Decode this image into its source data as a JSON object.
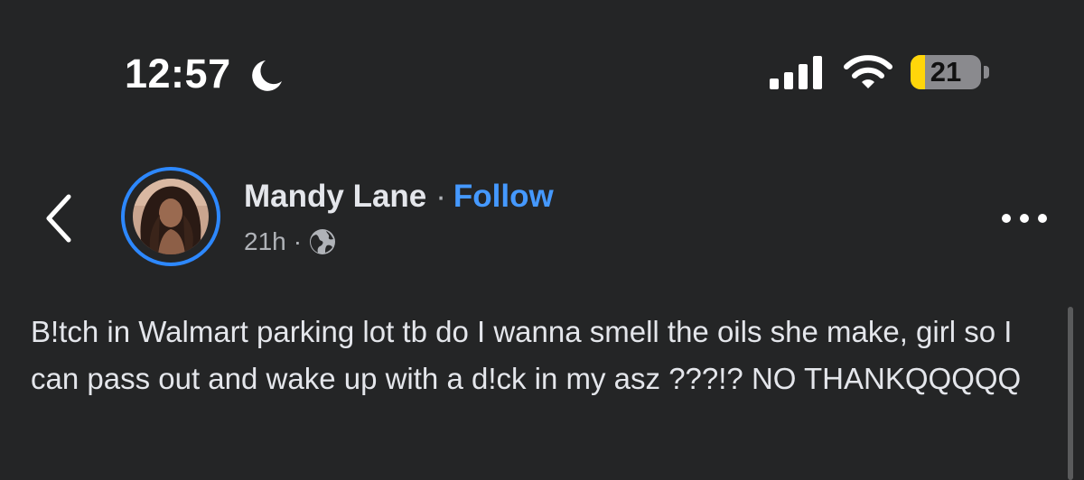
{
  "status_bar": {
    "time": "12:57",
    "battery_level": "21",
    "icons": [
      "moon-icon",
      "signal-icon",
      "wifi-icon",
      "battery-icon"
    ],
    "battery_fill_percent": 21,
    "battery_fill_color": "#ffd60a"
  },
  "post": {
    "author_name": "Mandy Lane",
    "separator": "·",
    "follow_label": "Follow",
    "timestamp": "21h",
    "meta_separator": "·",
    "audience_icon": "globe-icon",
    "text": "B!tch in Walmart parking lot tb do I wanna smell the oils she make, girl so I can pass out and wake up with a d!ck in my asz ???!? NO THANKQQQQQ"
  },
  "nav": {
    "back_icon": "chevron-left-icon",
    "more_icon": "more-dots-icon"
  },
  "colors": {
    "background": "#242526",
    "accent": "#4599ff",
    "avatar_ring": "#2d88ff",
    "primary_text": "#e4e6eb",
    "secondary_text": "#b0b3b8"
  }
}
